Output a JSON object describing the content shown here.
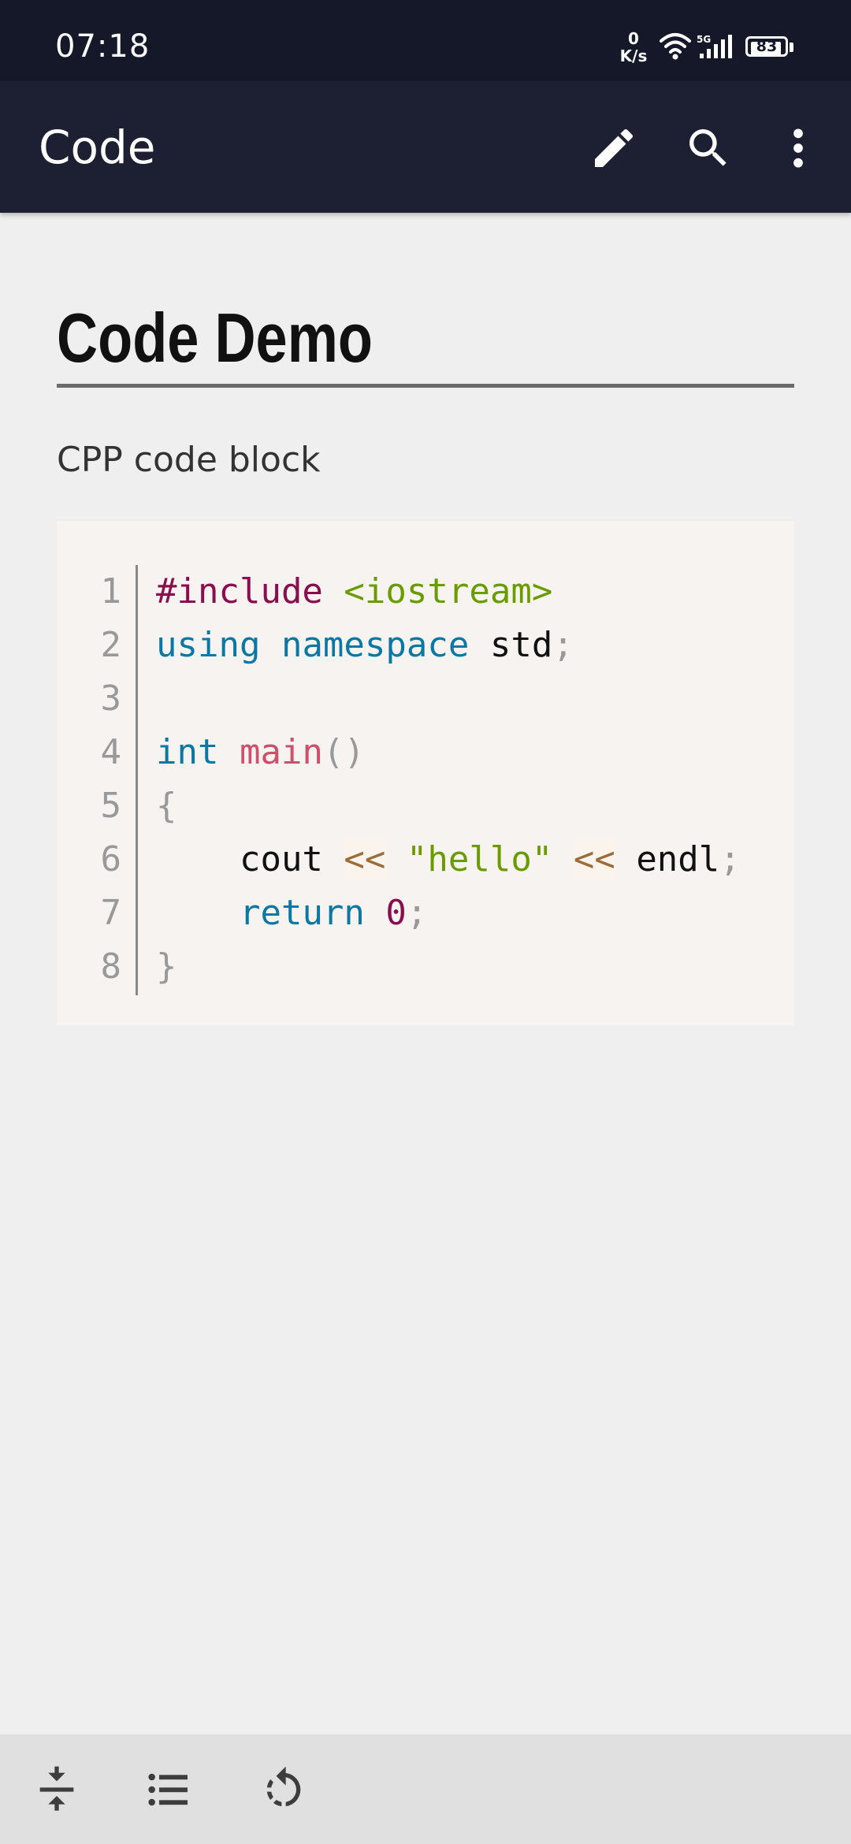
{
  "status_bar": {
    "time": "07:18",
    "net_speed_value": "0",
    "net_speed_unit": "K/s",
    "network_type": "5G",
    "battery_level": "83",
    "icons": [
      "wifi-icon",
      "signal-icon",
      "battery-icon"
    ]
  },
  "app_bar": {
    "title": "Code",
    "actions": [
      "edit-icon",
      "search-icon",
      "more-vert-icon"
    ]
  },
  "document": {
    "title": "Code Demo",
    "paragraph": "CPP code block",
    "code": {
      "line_numbers": [
        "1",
        "2",
        "3",
        "4",
        "5",
        "6",
        "7",
        "8"
      ],
      "lines": [
        [
          {
            "t": "#include",
            "c": "directive"
          },
          {
            "t": " ",
            "c": "plain"
          },
          {
            "t": "<iostream>",
            "c": "inc"
          }
        ],
        [
          {
            "t": "using",
            "c": "kw"
          },
          {
            "t": " ",
            "c": "plain"
          },
          {
            "t": "namespace",
            "c": "kw"
          },
          {
            "t": " std",
            "c": "plain"
          },
          {
            "t": ";",
            "c": "punc"
          }
        ],
        [],
        [
          {
            "t": "int",
            "c": "kw"
          },
          {
            "t": " ",
            "c": "plain"
          },
          {
            "t": "main",
            "c": "fn"
          },
          {
            "t": "()",
            "c": "punc"
          }
        ],
        [
          {
            "t": "{",
            "c": "punc"
          }
        ],
        [
          {
            "t": "    cout ",
            "c": "plain"
          },
          {
            "t": "<<",
            "c": "op"
          },
          {
            "t": " ",
            "c": "plain"
          },
          {
            "t": "\"hello\"",
            "c": "str"
          },
          {
            "t": " ",
            "c": "plain"
          },
          {
            "t": "<<",
            "c": "op"
          },
          {
            "t": " endl",
            "c": "plain"
          },
          {
            "t": ";",
            "c": "punc"
          }
        ],
        [
          {
            "t": "    ",
            "c": "plain"
          },
          {
            "t": "return",
            "c": "kw"
          },
          {
            "t": " ",
            "c": "plain"
          },
          {
            "t": "0",
            "c": "num"
          },
          {
            "t": ";",
            "c": "punc"
          }
        ],
        [
          {
            "t": "}",
            "c": "punc"
          }
        ]
      ]
    }
  },
  "bottom_bar": {
    "actions": [
      "collapse-icon",
      "toc-list-icon",
      "refresh-icon"
    ]
  },
  "colors": {
    "status_bar_bg": "#141829",
    "app_bar_bg": "#1d2033",
    "page_bg": "#efefef",
    "code_bg": "#f6f3f0",
    "bottom_bar_bg": "#e0e0e0"
  }
}
